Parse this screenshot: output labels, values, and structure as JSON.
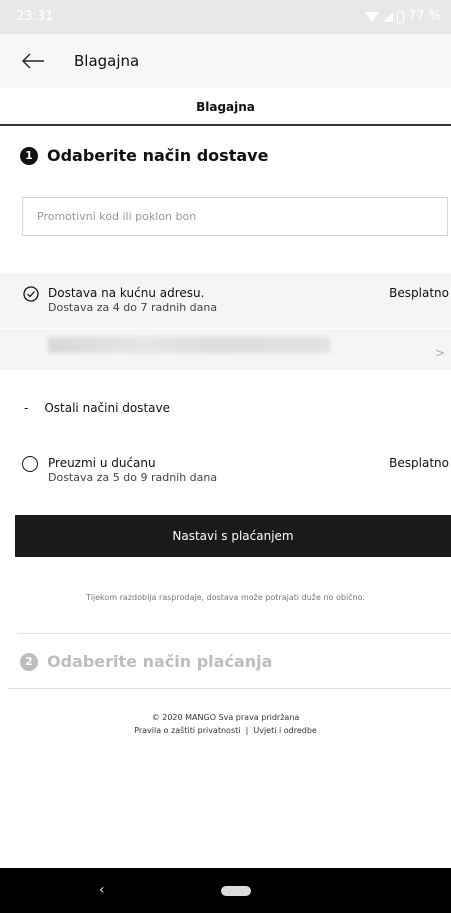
{
  "status_bar": {
    "time": "23:31",
    "battery": "77 %"
  },
  "app_bar": {
    "back_icon": "arrow-left-icon",
    "title": "Blagajna"
  },
  "tab": {
    "label": "Blagajna"
  },
  "step1": {
    "number": "1",
    "title": "Odaberite način dostave"
  },
  "promo": {
    "placeholder": "Promotivni kod ili poklon bon"
  },
  "home_delivery": {
    "icon": "check-circle-icon",
    "title": "Dostava na kućnu adresu.",
    "subtitle": "Dostava za 4 do 7 radnih dana",
    "price": "Besplatno",
    "chevron": "chevron-right-icon"
  },
  "other_methods": {
    "dash": "-",
    "label": "Ostali načini dostave"
  },
  "store_pickup": {
    "title": "Preuzmi u dućanu",
    "subtitle": "Dostava za 5 do 9 radnih dana",
    "price": "Besplatno"
  },
  "continue_button": {
    "label": "Nastavi s plaćanjem"
  },
  "notice": "Tijekom razdoblja rasprodaje, dostava može potrajati duže no obično.",
  "step2": {
    "number": "2",
    "title": "Odaberite način plaćanja"
  },
  "footer": {
    "copyright": "© 2020 MANGO Sva prava pridržana",
    "privacy": "Pravila o zaštiti privatnosti",
    "separator": "|",
    "terms": "Uvjeti i odredbe"
  },
  "nav_bar": {
    "back": "‹"
  },
  "colors": {
    "primary": "#1a1a1a",
    "disabled": "#bdbdbd",
    "panel": "#f5f5f5",
    "status_bar": "#e8e8e8"
  }
}
